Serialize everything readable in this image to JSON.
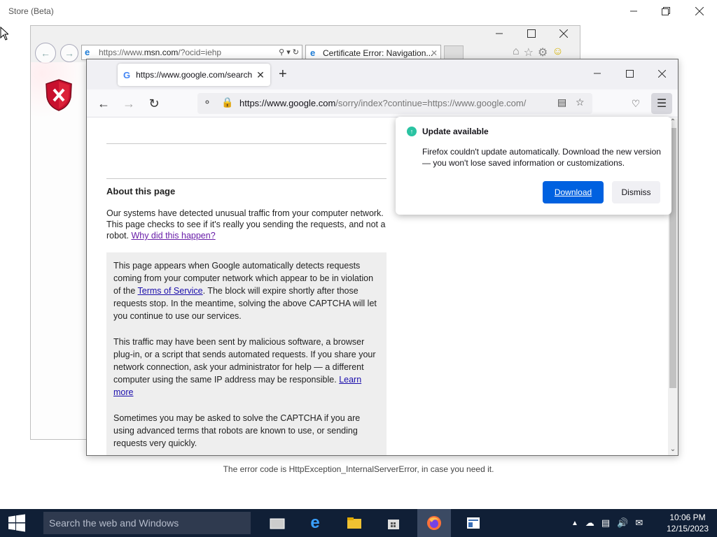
{
  "store": {
    "title": "Store (Beta)",
    "footer_text": "The error code is HttpException_InternalServerError, in case you need it."
  },
  "ie": {
    "address_prefix": "https://www.",
    "address_domain": "msn.com",
    "address_suffix": "/?ocid=iehp",
    "tab_title": "Certificate Error: Navigation..."
  },
  "firefox": {
    "tab_title": "https://www.google.com/search",
    "url_domain": "https://www.google.com",
    "url_path": "/sorry/index?continue=https://www.google.com/",
    "content": {
      "about_title": "About this page",
      "about_text": "Our systems have detected unusual traffic from your computer network. This page checks to see if it's really you sending the requests, and not a robot.",
      "why_link": "Why did this happen?",
      "box_p1_a": "This page appears when Google automatically detects requests coming from your computer network which appear to be in violation of the",
      "box_p1_link": "Terms of Service",
      "box_p1_b": ". The block will expire shortly after those requests stop. In the meantime, solving the above CAPTCHA will let you continue to use our services.",
      "box_p2_a": "This traffic may have been sent by malicious software, a browser plug-in, or a script that sends automated requests. If you share your network connection, ask your administrator for help — a different computer using the same IP address may be responsible.",
      "box_p2_link": "Learn more",
      "box_p3": "Sometimes you may be asked to solve the CAPTCHA if you are using advanced terms that robots are known to use, or sending requests very quickly."
    },
    "update_popup": {
      "title": "Update available",
      "body": "Firefox couldn't update automatically. Download the new version — you won't lose saved information or customizations.",
      "download_label": "Download",
      "dismiss_label": "Dismiss"
    }
  },
  "taskbar": {
    "search_placeholder": "Search the web and Windows",
    "time": "10:06 PM",
    "date": "12/15/2023"
  }
}
